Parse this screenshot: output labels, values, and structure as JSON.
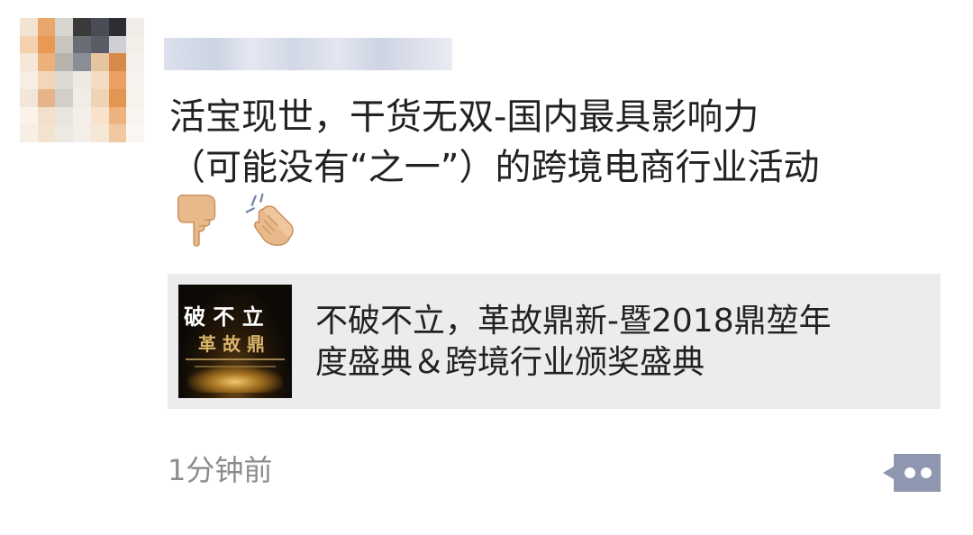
{
  "post": {
    "text_lines": [
      "活宝现世，干货无双-国内最具影响力",
      "（可能没有“之一”）的跨境电商行业活动"
    ],
    "emojis": [
      "backhand-index-pointing-down-emoji",
      "clapping-hands-emoji"
    ]
  },
  "link_card": {
    "title_lines": [
      "不破不立，革故鼎新-暨2018鼎堃年",
      "度盛典＆跨境行业颁奖盛典"
    ],
    "thumbnail_text": {
      "row1": "破 不 立",
      "row2": "革 故 鼎"
    }
  },
  "footer": {
    "timestamp": "1分钟前",
    "more_icon": "comment-like-menu-icon"
  },
  "colors": {
    "text": "#222222",
    "timestamp": "#8c8c8c",
    "card_bg": "#ececec",
    "more_button": "#8e96b0"
  }
}
